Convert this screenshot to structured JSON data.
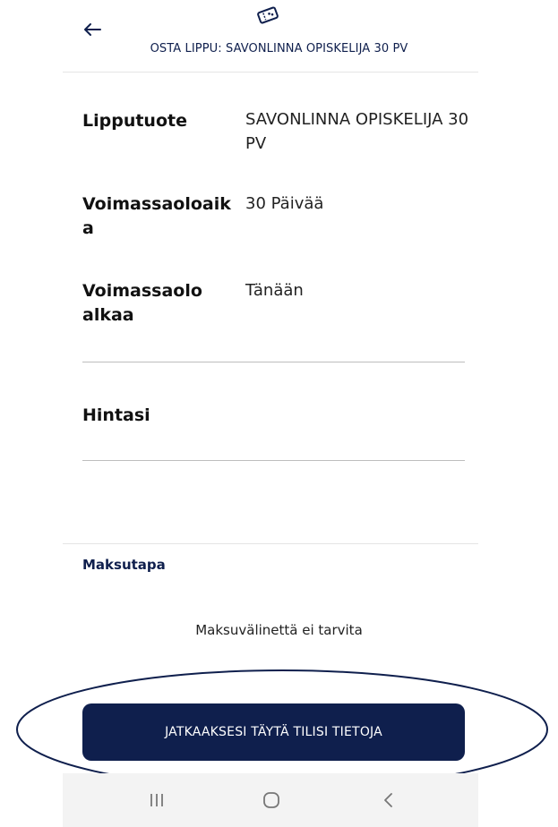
{
  "header": {
    "title": "OSTA LIPPU: SAVONLINNA OPISKELIJA 30 PV",
    "back_icon": "arrow-left-icon",
    "ticket_icon": "ticket-icon"
  },
  "details": [
    {
      "label": "Lipputuote",
      "value": "SAVONLINNA OPISKELIJA 30 PV"
    },
    {
      "label": "Voimassaoloaika",
      "value": "30 Päivää"
    },
    {
      "label": "Voimassaolo alkaa",
      "value": "Tänään"
    }
  ],
  "price": {
    "label": "Hintasi",
    "value": ""
  },
  "payment": {
    "title": "Maksutapa",
    "note": "Maksuvälinettä ei tarvita"
  },
  "cta": {
    "label": "JATKAAKSESI TÄYTÄ TILISI TIETOJA"
  },
  "annotation": {
    "shape": "ellipse",
    "color": "#0f1f4d"
  },
  "system_nav": {
    "items": [
      "recent-apps-icon",
      "home-icon",
      "back-chevron-icon"
    ]
  }
}
